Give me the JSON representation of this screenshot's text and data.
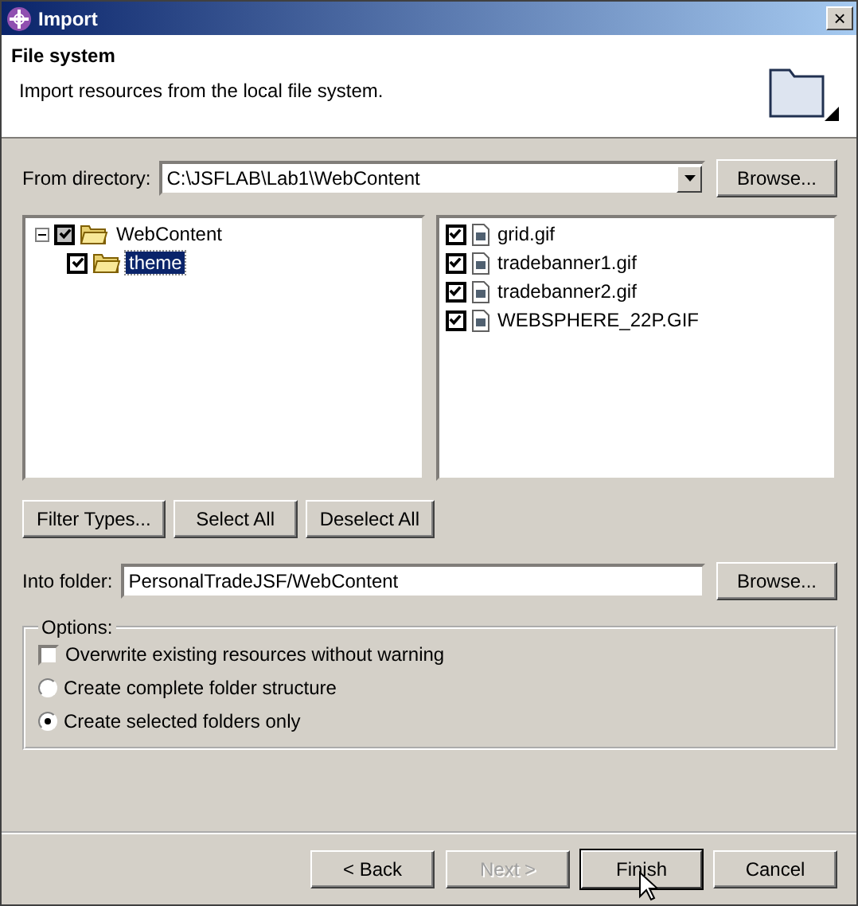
{
  "window": {
    "title": "Import",
    "close": "×"
  },
  "header": {
    "title": "File system",
    "description": "Import resources from the local file system."
  },
  "from_directory": {
    "label": "From directory:",
    "value": "C:\\JSFLAB\\Lab1\\WebContent",
    "browse": "Browse..."
  },
  "folder_tree": [
    {
      "label": "WebContent",
      "expanded": true,
      "checked": true,
      "grayed": true,
      "selected": false,
      "children": [
        {
          "label": "theme",
          "checked": true,
          "selected": true
        }
      ]
    }
  ],
  "files": [
    {
      "label": "grid.gif",
      "checked": true
    },
    {
      "label": "tradebanner1.gif",
      "checked": true
    },
    {
      "label": "tradebanner2.gif",
      "checked": true
    },
    {
      "label": "WEBSPHERE_22P.GIF",
      "checked": true
    }
  ],
  "selection_buttons": [
    "Filter Types...",
    "Select All",
    "Deselect All"
  ],
  "into_folder": {
    "label": "Into folder:",
    "value": "PersonalTradeJSF/WebContent",
    "browse": "Browse..."
  },
  "options": {
    "title": "Options:",
    "items": [
      {
        "kind": "checkbox",
        "label": "Overwrite existing resources without warning",
        "checked": false
      },
      {
        "kind": "radio",
        "label": "Create complete folder structure",
        "selected": false
      },
      {
        "kind": "radio",
        "label": "Create selected folders only",
        "selected": true
      }
    ]
  },
  "buttons": [
    {
      "label": "< Back",
      "disabled": false,
      "default": false
    },
    {
      "label": "Next >",
      "disabled": true,
      "default": false
    },
    {
      "label": "Finish",
      "disabled": false,
      "default": true
    },
    {
      "label": "Cancel",
      "disabled": false,
      "default": false
    }
  ]
}
